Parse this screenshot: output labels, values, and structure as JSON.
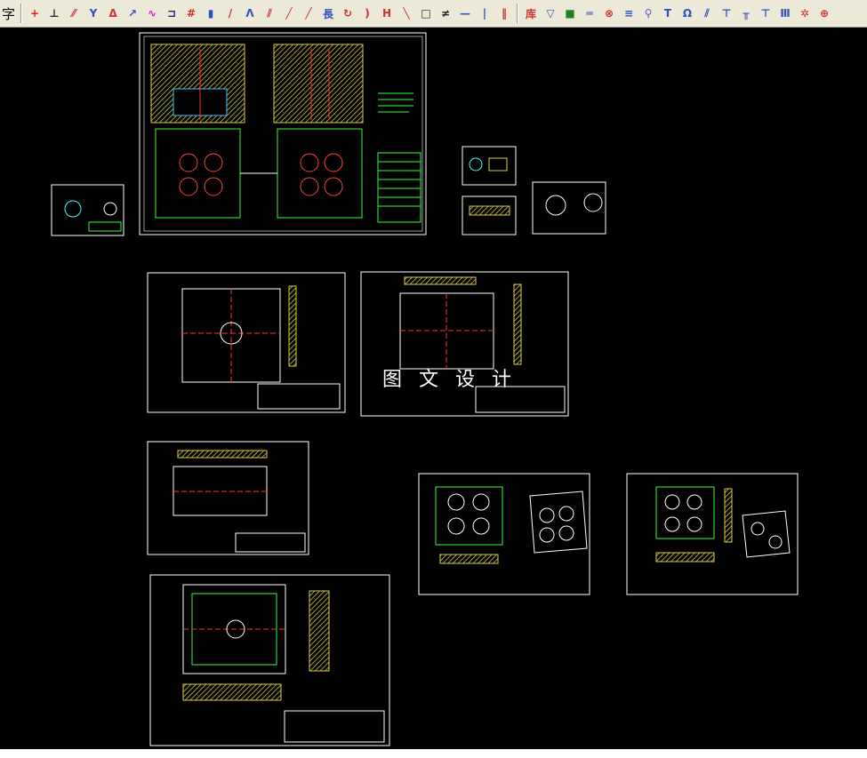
{
  "toolbar": {
    "left_label": "字",
    "groups": [
      [
        {
          "icon": "crosshair-icon",
          "glyph": "+",
          "color": "#e02020"
        },
        {
          "icon": "dimension-icon",
          "glyph": "⊥",
          "color": "#202020"
        },
        {
          "icon": "hatch-icon",
          "glyph": "⁄⁄",
          "color": "#d04040"
        },
        {
          "icon": "weld-icon",
          "glyph": "Y",
          "color": "#3050c0"
        },
        {
          "icon": "angle-dim-icon",
          "glyph": "Δ",
          "color": "#d03030"
        },
        {
          "icon": "arrow-dim-icon",
          "glyph": "↗",
          "color": "#3050c0"
        },
        {
          "icon": "polyline-icon",
          "glyph": "∿",
          "color": "#c020c0"
        },
        {
          "icon": "bracket-icon",
          "glyph": "⊐",
          "color": "#202080"
        },
        {
          "icon": "grid-icon",
          "glyph": "#",
          "color": "#d03030"
        },
        {
          "icon": "section-icon",
          "glyph": "▮",
          "color": "#3050c0"
        },
        {
          "icon": "taper-icon",
          "glyph": "/",
          "color": "#d03030"
        },
        {
          "icon": "triangle-icon",
          "glyph": "Λ",
          "color": "#3050c0"
        },
        {
          "icon": "oblique-hatch-icon",
          "glyph": "⫽",
          "color": "#d04040"
        },
        {
          "icon": "line-icon",
          "glyph": "╱",
          "color": "#d03030"
        },
        {
          "icon": "diagonal-icon",
          "glyph": "╱",
          "color": "#d03030"
        },
        {
          "icon": "long-text-icon",
          "glyph": "長",
          "color": "#3050c0"
        },
        {
          "icon": "rotate-icon",
          "glyph": "↻",
          "color": "#d03030"
        },
        {
          "icon": "arc-icon",
          "glyph": ")",
          "color": "#d03030"
        },
        {
          "icon": "vertical-dim-icon",
          "glyph": "H",
          "color": "#d03030"
        },
        {
          "icon": "slash-icon",
          "glyph": "╲",
          "color": "#d03030"
        },
        {
          "icon": "rectangle-icon",
          "glyph": "□",
          "color": "#202020"
        },
        {
          "icon": "equal-icon",
          "glyph": "≠",
          "color": "#202020"
        },
        {
          "icon": "horizontal-bar-icon",
          "glyph": "—",
          "color": "#3050c0"
        },
        {
          "icon": "vertical-bar-icon",
          "glyph": "|",
          "color": "#3050c0"
        },
        {
          "icon": "split-icon",
          "glyph": "‖",
          "color": "#d03030"
        }
      ],
      [
        {
          "icon": "library-icon",
          "glyph": "库",
          "color": "#d03030"
        },
        {
          "icon": "funnel-icon",
          "glyph": "▽",
          "color": "#3050c0"
        },
        {
          "icon": "block-icon",
          "glyph": "■",
          "color": "#208020"
        },
        {
          "icon": "pipe-icon",
          "glyph": "═",
          "color": "#3050c0"
        },
        {
          "icon": "circle-cross-icon",
          "glyph": "⊗",
          "color": "#d03030"
        },
        {
          "icon": "stack-icon",
          "glyph": "≡",
          "color": "#3050c0"
        },
        {
          "icon": "screw-icon",
          "glyph": "⚲",
          "color": "#7050c0"
        },
        {
          "icon": "t-joint-icon",
          "glyph": "T",
          "color": "#3050c0"
        },
        {
          "icon": "bulb-icon",
          "glyph": "Ω",
          "color": "#3050c0"
        },
        {
          "icon": "stripes-icon",
          "glyph": "⫽",
          "color": "#3050c0"
        },
        {
          "icon": "post-icon",
          "glyph": "⊤",
          "color": "#3050c0"
        },
        {
          "icon": "double-post-icon",
          "glyph": "╥",
          "color": "#3050c0"
        },
        {
          "icon": "pin-icon",
          "glyph": "⊤",
          "color": "#3050c0"
        },
        {
          "icon": "column-icon",
          "glyph": "Ⅲ",
          "color": "#3050c0"
        },
        {
          "icon": "gear-icon",
          "glyph": "✲",
          "color": "#d03030"
        },
        {
          "icon": "target-icon",
          "glyph": "⊕",
          "color": "#d03030"
        }
      ]
    ]
  },
  "watermark": "图 文 设 计"
}
